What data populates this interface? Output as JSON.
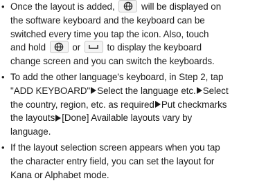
{
  "bullets": [
    {
      "lines": [
        [
          "Once the layout is added,",
          "will be displayed on"
        ],
        "the software keyboard and the keyboard can be",
        "switched every time you tap the icon. Also, touch",
        [
          "and hold",
          "or",
          "to display the keyboard"
        ],
        "change screen and you can switch the keyboards."
      ]
    },
    {
      "lines": [
        "To add the other language's keyboard, in Step 2, tap",
        [
          "\"ADD KEYBOARD\"",
          "Select the language etc.",
          "Select"
        ],
        [
          "the country, region, etc. as required",
          "Put checkmarks"
        ],
        [
          "the layouts",
          "[Done] Available layouts vary by"
        ],
        "language."
      ]
    },
    {
      "lines": [
        "If the layout selection screen appears when you tap",
        "the character entry field, you can set the layout for",
        "Kana or Alphabet mode."
      ]
    }
  ],
  "icons": {
    "globe": "globe-icon",
    "space": "space-bar-icon",
    "arrow": "right-triangle-arrow-icon"
  }
}
